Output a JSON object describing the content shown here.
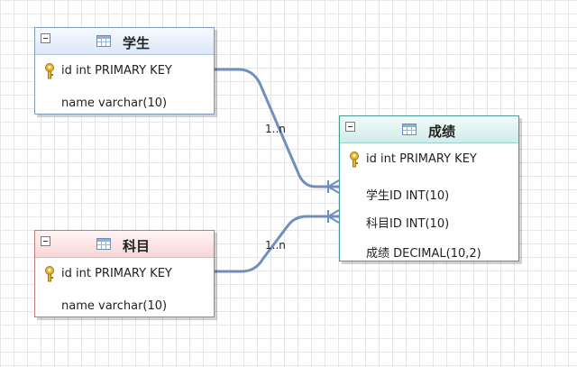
{
  "entities": {
    "student": {
      "title": "学生",
      "fields": [
        "id int PRIMARY KEY",
        "name varchar(10)"
      ]
    },
    "subject": {
      "title": "科目",
      "fields": [
        "id int PRIMARY KEY",
        "name varchar(10)"
      ]
    },
    "score": {
      "title": "成绩",
      "fields": [
        "id int PRIMARY KEY",
        "学生ID INT(10)",
        "科目ID INT(10)",
        "成绩 DECIMAL(10,2)"
      ]
    }
  },
  "relationships": [
    {
      "from": "学生",
      "to": "成绩",
      "label": "1..n"
    },
    {
      "from": "科目",
      "to": "成绩",
      "label": "1..n"
    }
  ],
  "colors": {
    "student_accent": "#7f9db9",
    "subject_accent": "#c07a7a",
    "score_accent": "#4a9a94",
    "connector": "#6f8fbf"
  },
  "icons": {
    "collapse": "collapse-icon",
    "table": "table-icon",
    "primary_key": "key-icon"
  }
}
